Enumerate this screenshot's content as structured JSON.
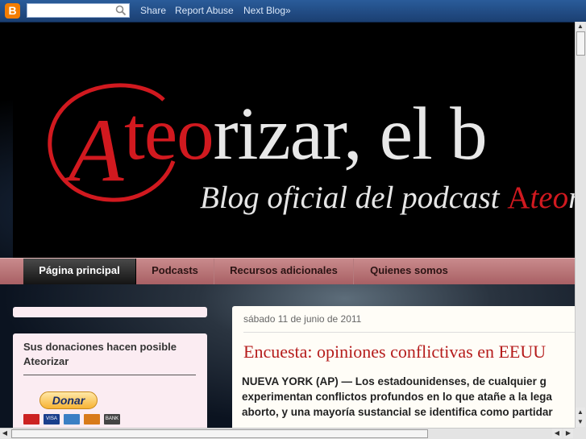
{
  "navbar": {
    "logo_letter": "B",
    "search_placeholder": "",
    "links": [
      "Share",
      "Report Abuse",
      "Next Blog»"
    ]
  },
  "header": {
    "title_prefix": "A",
    "title_red": "teo",
    "title_rest": "rizar, el b",
    "subtitle_text": "Blog oficial del podcast ",
    "subtitle_logo": "A",
    "subtitle_red": "teo",
    "subtitle_rest": "ri"
  },
  "tabs": [
    {
      "label": "Página principal",
      "active": true
    },
    {
      "label": "Podcasts",
      "active": false
    },
    {
      "label": "Recursos adicionales",
      "active": false
    },
    {
      "label": "Quienes somos",
      "active": false
    }
  ],
  "sidebar": {
    "donation_title": "Sus donaciones hacen posible Ateorizar",
    "donate_label": "Donar",
    "cards": [
      "",
      "VISA",
      "",
      "",
      "BANK"
    ]
  },
  "post": {
    "date": "sábado 11 de junio de 2011",
    "title": "Encuesta: opiniones conflictivas en EEUU",
    "lines": [
      "NUEVA YORK (AP) — Los estadounidenses, de cualquier g",
      "experimentan conflictos profundos en lo que atañe a la lega",
      "aborto, y una mayoría sustancial se identifica como partidar"
    ]
  },
  "colors": {
    "accent_red": "#d1191f",
    "tab_bar": "#b57074",
    "post_bg": "#fffdf7",
    "sidebar_bg": "#fbecf2"
  }
}
